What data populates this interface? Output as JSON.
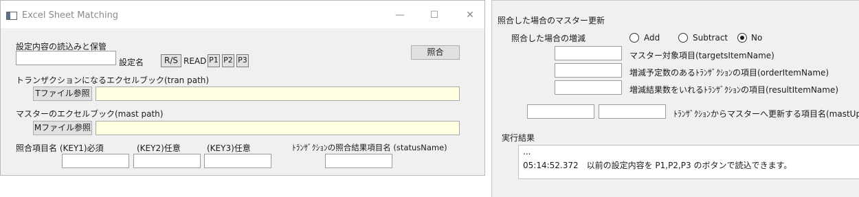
{
  "window": {
    "title": "Excel Sheet Matching",
    "minimize_glyph": "—",
    "maximize_glyph": "☐",
    "close_glyph": "✕"
  },
  "settings": {
    "section_label": "設定内容の読込みと保管",
    "name_label": "設定名",
    "name_value": "",
    "rs_button": "R/S",
    "read_label": "READ",
    "p1_button": "P1",
    "p2_button": "P2",
    "p3_button": "P3",
    "match_button": "照合"
  },
  "tran": {
    "label": "トランザクションになるエクセルブック(tran path)",
    "browse_button": "Tファイル参照",
    "path_value": ""
  },
  "mast": {
    "label": "マスターのエクセルブック(mast path)",
    "browse_button": "Mファイル参照",
    "path_value": ""
  },
  "keys": {
    "key1_label": "照合項目名 (KEY1)必須",
    "key2_label": "(KEY2)任意",
    "key3_label": "(KEY3)任意",
    "status_label": "ﾄﾗﾝｻﾞｸｼｮﾝの照合結果項目名 (statusName)"
  },
  "update": {
    "section_label": "照合した場合のマスター更新",
    "mode_label": "照合した場合の増減",
    "options": [
      "Add",
      "Subtract",
      "No"
    ],
    "selected": "No",
    "targets_label": "マスター対象項目(targetsItemName)",
    "order_label": "増減予定数のあるﾄﾗﾝｻﾞｸｼｮﾝの項目(orderItemName)",
    "result_label": "増減結果数をいれるﾄﾗﾝｻﾞｸｼｮﾝの項目(resultItemName)",
    "mast_update_label": "ﾄﾗﾝｻﾞｸｼｮﾝからマスターへ更新する項目名(mastUpda"
  },
  "result": {
    "section_label": "実行結果",
    "lines": [
      "...",
      "05:14:52.372　以前の設定内容を P1,P2,P3 のボタンで読込できます。"
    ]
  }
}
